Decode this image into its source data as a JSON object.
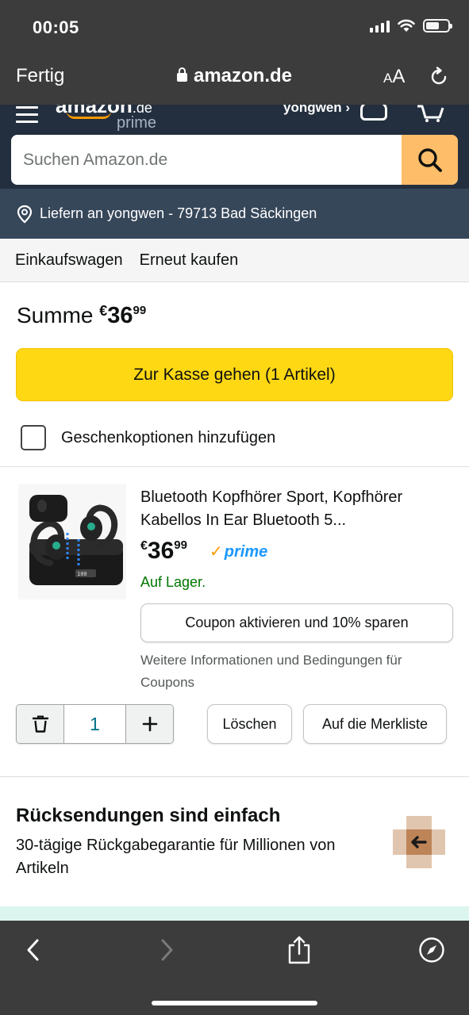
{
  "status_bar": {
    "time": "00:05"
  },
  "safari": {
    "done_label": "Fertig",
    "url": "amazon.de",
    "text_size_label_small": "A",
    "text_size_label_large": "A"
  },
  "header": {
    "logo_text": "amazon",
    "logo_domain": ".de",
    "logo_prime": "prime",
    "user_label": "yongwen ›"
  },
  "search": {
    "placeholder": "Suchen Amazon.de"
  },
  "delivery": {
    "text": "Liefern an yongwen - 79713 Bad Säckingen"
  },
  "subnav": {
    "items": [
      "Einkaufswagen",
      "Erneut kaufen"
    ]
  },
  "cart": {
    "subtotal_label": "Summe",
    "subtotal_currency": "€",
    "subtotal_whole": "36",
    "subtotal_fraction": "99",
    "checkout_label": "Zur Kasse gehen (1 Artikel)",
    "gift_label": "Geschenkoptionen hinzufügen"
  },
  "item": {
    "title": "Bluetooth Kopfhörer Sport, Kopfhörer Kabellos In Ear Bluetooth 5...",
    "price_currency": "€",
    "price_whole": "36",
    "price_fraction": "99",
    "prime_label": "prime",
    "stock": "Auf Lager.",
    "coupon_label": "Coupon aktivieren und 10% sparen",
    "coupon_info": "Weitere Informationen und Bedingungen für Coupons",
    "quantity": "1",
    "delete_label": "Löschen",
    "save_label": "Auf die Merkliste"
  },
  "returns": {
    "title": "Rücksendungen sind einfach",
    "text": "30-tägige Rückgabegarantie für Millionen von Artikeln"
  },
  "colors": {
    "header_bg": "#232f3e",
    "delivery_bg": "#37475a",
    "checkout_yellow": "#ffd814",
    "search_button": "#febd69",
    "in_stock_green": "#007600",
    "prime_blue": "#1a98ff",
    "browser_chrome": "#3c3c3c"
  }
}
